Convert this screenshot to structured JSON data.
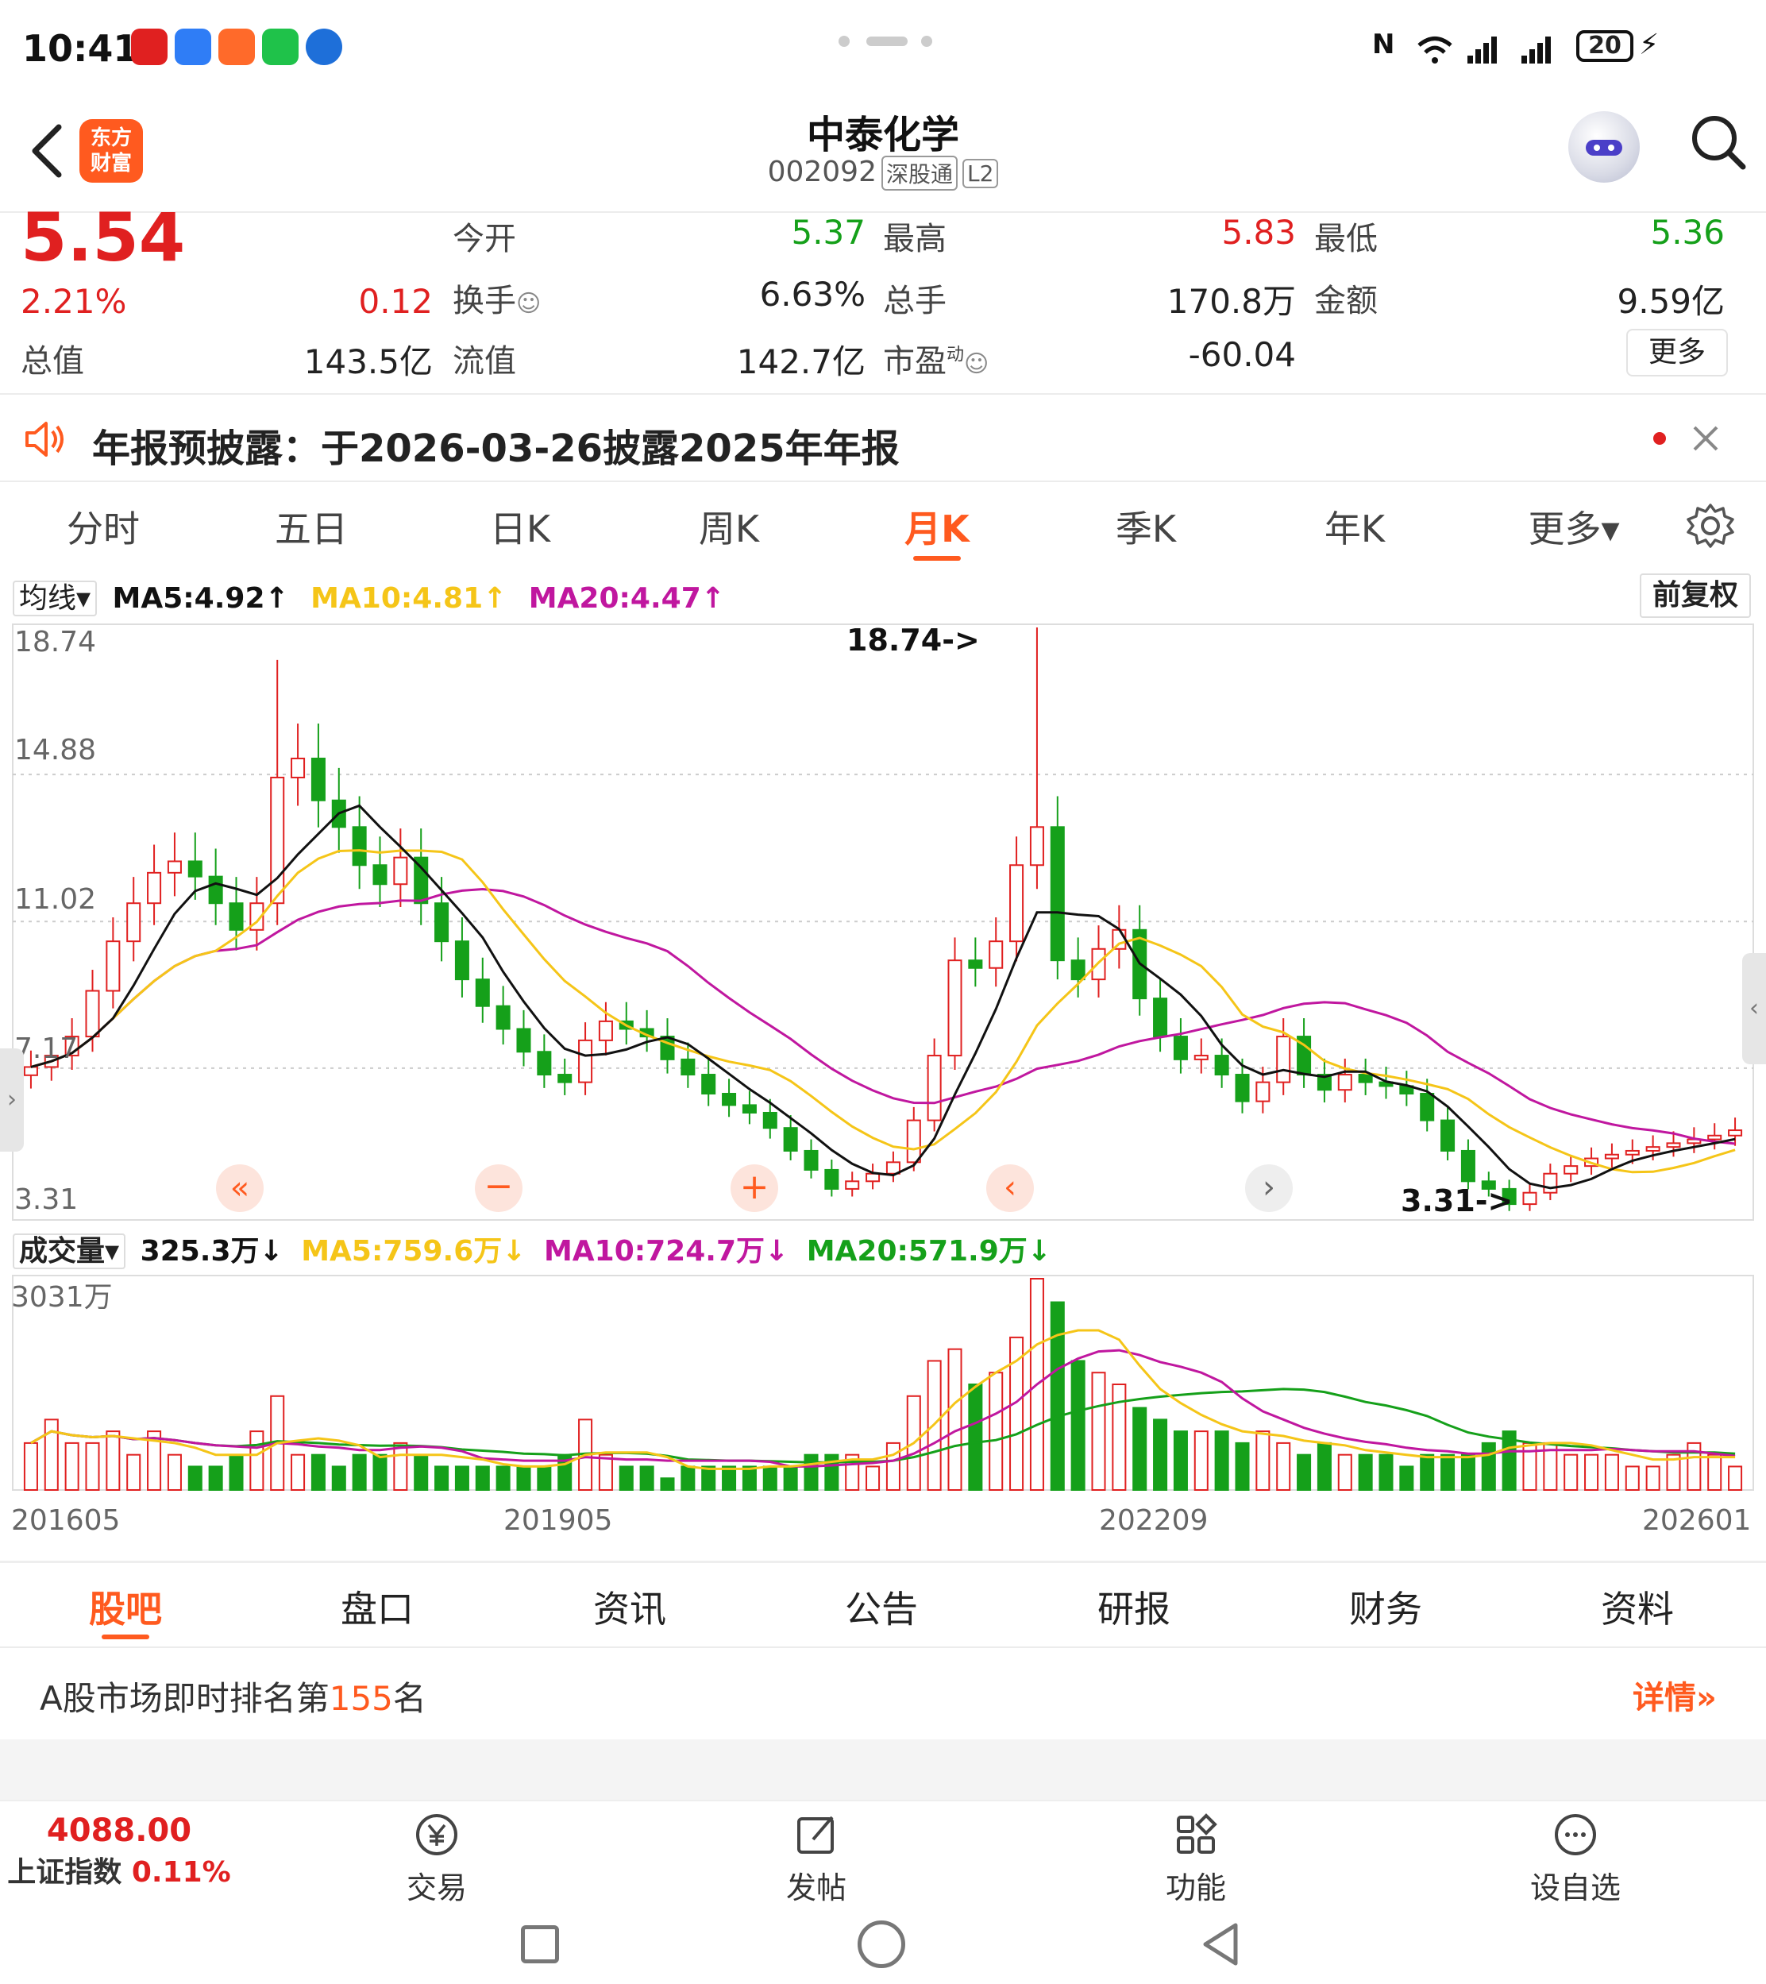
{
  "status_bar": {
    "time": "10:41",
    "battery": "20"
  },
  "header": {
    "brand": "东方财富",
    "title": "中泰化学",
    "code": "002092",
    "tags": [
      "深股通",
      "L2"
    ]
  },
  "quote": {
    "price": "5.54",
    "change_pct": "2.21%",
    "change": "0.12",
    "open_label": "今开",
    "open": "5.37",
    "high_label": "最高",
    "high": "5.83",
    "low_label": "最低",
    "low": "5.36",
    "turnover_label": "换手",
    "turnover": "6.63%",
    "volume_label": "总手",
    "volume": "170.8万",
    "amount_label": "金额",
    "amount": "9.59亿",
    "mktcap_label": "总值",
    "mktcap": "143.5亿",
    "float_label": "流值",
    "float_cap": "142.7亿",
    "pe_label": "市盈",
    "pe_sup": "动",
    "pe": "-60.04",
    "more_label": "更多"
  },
  "notice": {
    "text": "年报预披露：于2026-03-26披露2025年年报"
  },
  "period_tabs": [
    "分时",
    "五日",
    "日K",
    "周K",
    "月K",
    "季K",
    "年K",
    "更多▾"
  ],
  "active_period": "月K",
  "colors": {
    "accent": "#ff5a1f",
    "up": "#e02020",
    "down": "#15a01a",
    "ma5": "#111111",
    "ma10": "#f5c518",
    "ma20": "#c0179f"
  },
  "indicators": {
    "ma_label": "均线",
    "ma5": "MA5:4.92↑",
    "ma10": "MA10:4.81↑",
    "ma20": "MA20:4.47↑",
    "adjust": "前复权",
    "vol_label": "成交量",
    "vol_value": "325.3万↓",
    "vol_ma5": "MA5:759.6万↓",
    "vol_ma10": "MA10:724.7万↓",
    "vol_ma20": "MA20:571.9万↓"
  },
  "chart_data": {
    "type": "candlestick",
    "period": "monthly",
    "y_ticks": [
      "18.74",
      "14.88",
      "11.02",
      "7.17",
      "3.31"
    ],
    "ylim": [
      3.31,
      18.74
    ],
    "max_annotation": "18.74->",
    "min_annotation": "3.31->",
    "volume_max_label": "3031万",
    "x_labels": [
      "201605",
      "201905",
      "202209",
      "202601"
    ],
    "close_series": [
      7.2,
      7.5,
      8.0,
      9.2,
      10.5,
      11.5,
      12.3,
      12.6,
      12.2,
      11.5,
      10.8,
      11.5,
      14.8,
      15.3,
      14.2,
      13.5,
      12.5,
      12.0,
      12.7,
      11.5,
      10.5,
      9.5,
      8.8,
      8.2,
      7.6,
      7.0,
      6.8,
      7.9,
      8.4,
      8.2,
      8.0,
      7.4,
      7.0,
      6.5,
      6.2,
      6.0,
      5.6,
      5.0,
      4.5,
      4.0,
      4.2,
      4.4,
      4.7,
      5.8,
      7.5,
      10.0,
      9.8,
      10.5,
      12.5,
      13.5,
      10.0,
      9.5,
      10.3,
      10.8,
      9.0,
      8.0,
      7.4,
      7.5,
      7.0,
      6.3,
      6.8,
      8.0,
      7.0,
      6.6,
      7.0,
      6.8,
      6.7,
      6.5,
      5.8,
      5.0,
      4.2,
      4.0,
      3.6,
      3.9,
      4.4,
      4.6,
      4.8,
      4.9,
      5.0,
      5.1,
      5.2,
      5.3,
      5.4,
      5.54
    ],
    "volume_series": [
      4,
      6,
      4,
      4,
      5,
      3,
      5,
      3,
      2,
      2,
      3,
      5,
      8,
      3,
      3,
      2,
      3,
      3,
      4,
      3,
      2,
      2,
      2,
      2,
      2,
      2,
      3,
      6,
      3,
      2,
      2,
      1,
      2,
      2,
      2,
      2,
      2,
      2,
      3,
      3,
      3,
      2,
      4,
      8,
      11,
      12,
      9,
      10,
      13,
      18,
      16,
      11,
      10,
      9,
      7,
      6,
      5,
      5,
      5,
      4,
      5,
      4,
      3,
      4,
      3,
      3,
      3,
      2,
      3,
      3,
      3,
      4,
      5,
      4,
      4,
      3,
      3,
      3,
      2,
      2,
      3,
      4,
      3,
      2
    ]
  },
  "content_tabs": [
    "股吧",
    "盘口",
    "资讯",
    "公告",
    "研报",
    "财务",
    "资料"
  ],
  "active_content_tab": "股吧",
  "ranking": {
    "prefix": "A股市场即时排名第",
    "rank": "155",
    "suffix": "名",
    "detail": "详情"
  },
  "bottom_nav": {
    "index_value": "4088.00",
    "index_name": "上证指数",
    "index_change": "0.11%",
    "items": [
      "交易",
      "发帖",
      "功能",
      "设自选"
    ]
  }
}
